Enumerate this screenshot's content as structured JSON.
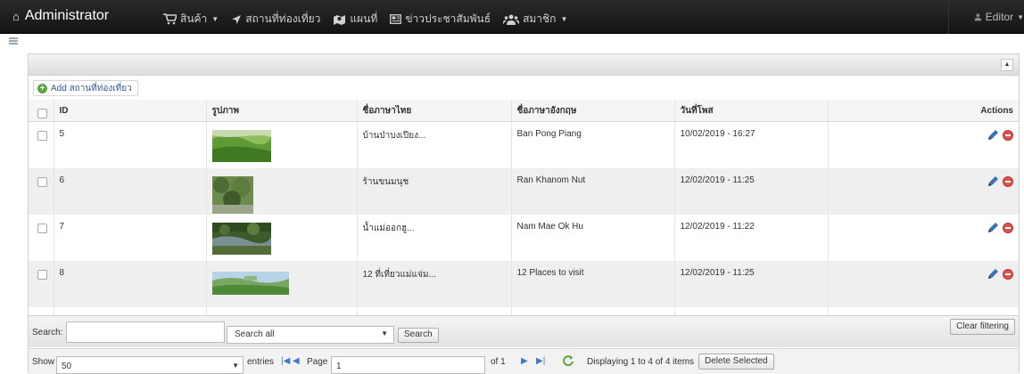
{
  "navbar": {
    "brand": "Administrator",
    "menu": [
      {
        "icon": "cart-icon",
        "label": "สินค้า",
        "dropdown": true
      },
      {
        "icon": "location-arrow-icon",
        "label": "สถานที่ท่องเที่ยว",
        "dropdown": false
      },
      {
        "icon": "map-icon",
        "label": "แผนที่",
        "dropdown": false
      },
      {
        "icon": "news-icon",
        "label": "ข่าวประชาสัมพันธ์",
        "dropdown": false
      },
      {
        "icon": "users-icon",
        "label": "สมาชิก",
        "dropdown": true
      }
    ],
    "user": "Editor"
  },
  "grid": {
    "add_label": "Add สถานที่ท่องเที่ยว",
    "columns": [
      "ID",
      "รูปภาพ",
      "ชื่อภาษาไทย",
      "ชื่อภาษาอังกฤษ",
      "วันที่โพส",
      "Actions"
    ],
    "rows": [
      {
        "id": "5",
        "thumb": "green-hills",
        "name_th": "บ้านป่าบงเปียง...",
        "name_en": "Ban Pong Piang",
        "posted": "10/02/2019 - 16:27"
      },
      {
        "id": "6",
        "thumb": "forest",
        "name_th": "ร้านขนมนุช",
        "name_en": "Ran Khanom Nut",
        "posted": "12/02/2019 - 11:25"
      },
      {
        "id": "7",
        "thumb": "stream",
        "name_th": "น้ำแม่ออกฮู...",
        "name_en": "Nam Mae Ok Hu",
        "posted": "12/02/2019 - 11:22"
      },
      {
        "id": "8",
        "thumb": "valley",
        "name_th": "12 ที่เที่ยวแม่แจ่ม...",
        "name_en": "12 Places to visit",
        "posted": "12/02/2019 - 11:25"
      }
    ]
  },
  "search": {
    "label": "Search:",
    "value": "",
    "scope": "Search all",
    "button": "Search",
    "clear": "Clear filtering"
  },
  "pager": {
    "show_label": "Show",
    "per_page": "50",
    "entries_label": "entries",
    "page_label": "Page",
    "page": "1",
    "of_label": "of 1",
    "status": "Displaying 1 to 4 of 4 items",
    "delete_selected": "Delete Selected"
  },
  "colors": {
    "navbar": "#1b1b1b",
    "accent_link": "#2e5c98",
    "delete_red": "#d9534f",
    "add_green": "#58a642"
  }
}
